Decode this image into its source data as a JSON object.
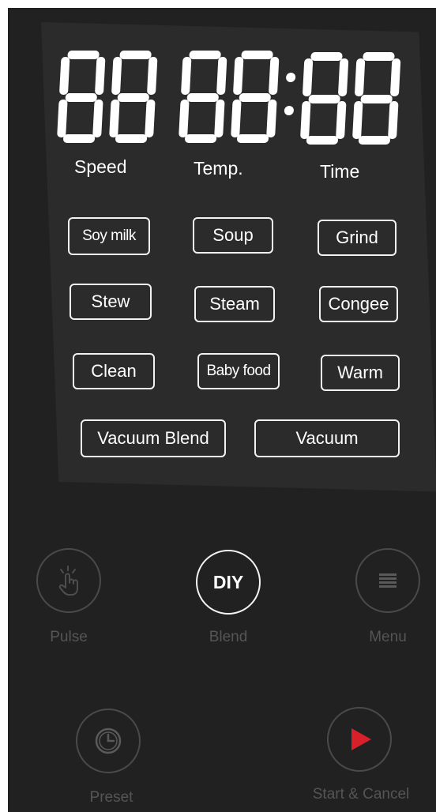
{
  "display": {
    "indicators": {
      "speed": "Speed",
      "temp": "Temp.",
      "time": "Time"
    }
  },
  "modes": [
    {
      "label": "Soy milk"
    },
    {
      "label": "Soup"
    },
    {
      "label": "Grind"
    },
    {
      "label": "Stew"
    },
    {
      "label": "Steam"
    },
    {
      "label": "Congee"
    },
    {
      "label": "Clean"
    },
    {
      "label": "Baby food"
    },
    {
      "label": "Warm"
    },
    {
      "label": "Vacuum Blend"
    },
    {
      "label": "Vacuum"
    }
  ],
  "controls": {
    "pulse": {
      "label": "Pulse",
      "icon": "hand-tap-icon"
    },
    "blend": {
      "label": "Blend",
      "icon_text": "DIY"
    },
    "menu": {
      "label": "Menu",
      "icon": "menu-lines-icon"
    },
    "preset": {
      "label": "Preset",
      "icon": "clock-icon"
    },
    "start": {
      "label": "Start & Cancel",
      "icon": "play-icon"
    }
  },
  "colors": {
    "device_bg": "#212121",
    "panel_bg": "#2b2b2b",
    "segment": "#ffffff",
    "play": "#d8202a",
    "dim_text": "#555555"
  }
}
